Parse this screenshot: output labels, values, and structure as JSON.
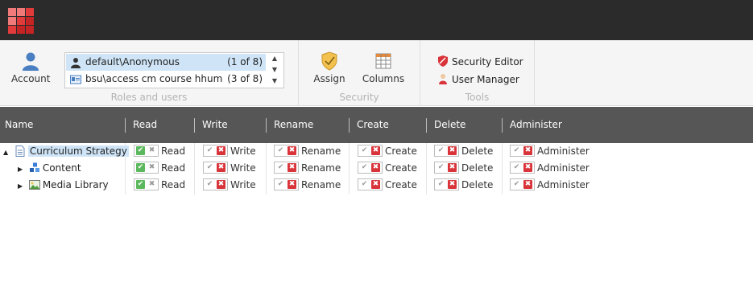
{
  "app": {
    "launch_icon": "app-launcher-icon"
  },
  "ribbon": {
    "account_label": "Account",
    "roles": [
      {
        "name": "default\\Anonymous",
        "count": "(1 of 8)",
        "icon": "user-icon",
        "selected": true
      },
      {
        "name": "bsu\\access cm course hhum",
        "count": "(3 of 8)",
        "icon": "role-card-icon",
        "selected": false
      }
    ],
    "roles_group_label": "Roles and users",
    "assign_label": "Assign",
    "columns_label": "Columns",
    "security_group_label": "Security",
    "security_editor_label": "Security Editor",
    "user_manager_label": "User Manager",
    "tools_group_label": "Tools"
  },
  "columns": [
    "Name",
    "Read",
    "Write",
    "Rename",
    "Create",
    "Delete",
    "Administer"
  ],
  "rows": [
    {
      "name": "Curriculum Strategy",
      "icon": "document-icon",
      "expander": "▲",
      "selected": true,
      "perms": [
        {
          "label": "Read",
          "state": "allow"
        },
        {
          "label": "Write",
          "state": "deny"
        },
        {
          "label": "Rename",
          "state": "deny"
        },
        {
          "label": "Create",
          "state": "deny"
        },
        {
          "label": "Delete",
          "state": "deny"
        },
        {
          "label": "Administer",
          "state": "deny"
        }
      ]
    },
    {
      "name": "Content",
      "icon": "content-cubes-icon",
      "expander": "▶",
      "selected": false,
      "perms": [
        {
          "label": "Read",
          "state": "allow"
        },
        {
          "label": "Write",
          "state": "deny"
        },
        {
          "label": "Rename",
          "state": "deny"
        },
        {
          "label": "Create",
          "state": "deny"
        },
        {
          "label": "Delete",
          "state": "deny"
        },
        {
          "label": "Administer",
          "state": "deny"
        }
      ]
    },
    {
      "name": "Media Library",
      "icon": "media-image-icon",
      "expander": "▶",
      "selected": false,
      "perms": [
        {
          "label": "Read",
          "state": "allow"
        },
        {
          "label": "Write",
          "state": "deny"
        },
        {
          "label": "Rename",
          "state": "deny"
        },
        {
          "label": "Create",
          "state": "deny"
        },
        {
          "label": "Delete",
          "state": "deny"
        },
        {
          "label": "Administer",
          "state": "deny"
        }
      ]
    }
  ],
  "colors": {
    "allow": "#5cb85c",
    "deny": "#d9343a",
    "header": "#565656",
    "selection": "#cfe5f7"
  }
}
